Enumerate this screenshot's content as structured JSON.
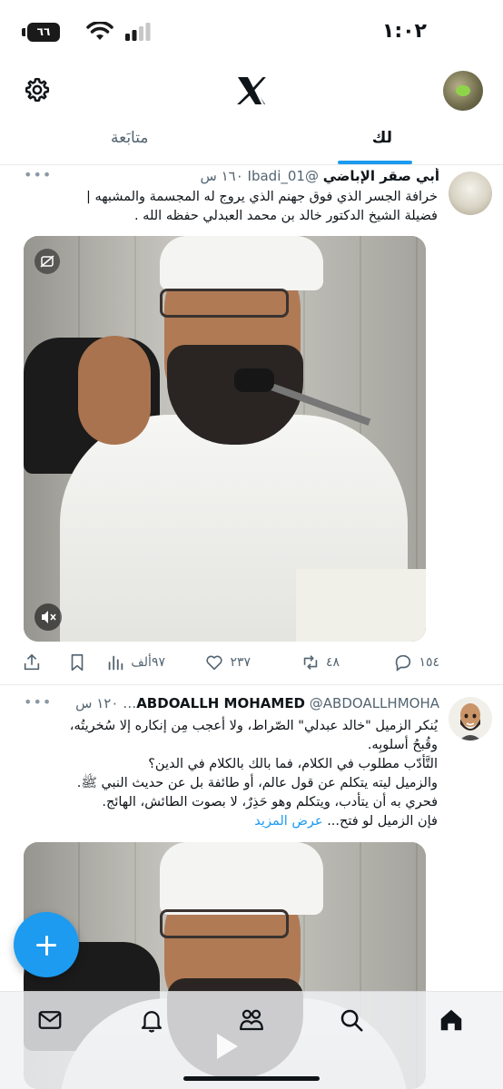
{
  "status_bar": {
    "time": "١:٠٢",
    "battery_level": "٦٦"
  },
  "header": {
    "logo": "x-logo-icon",
    "settings_icon": "gear-icon",
    "profile_icon": "avatar"
  },
  "tabs": {
    "for_you": "لك",
    "following": "متابَعة",
    "active": "لك"
  },
  "tweets": [
    {
      "name": "أبي صقر الإباضي",
      "handle": "@Ibadi_01",
      "time": "١٦٠ س",
      "lines": [
        "خرافة الجسر الذي فوق جهنم الذي يروج له المجسمة والمشبهه |",
        "فضيلة الشيخ الدكتور خالد بن محمد العبدلي حفظه الله ."
      ],
      "stats": {
        "replies": "١٥٤",
        "retweets": "٤٨",
        "likes": "٢٣٧",
        "views": "٩٧ألف"
      }
    },
    {
      "name": "ABDOALLH MOHAMED",
      "handle": "@ABDOALLHMOHA…",
      "time": "١٢٠ س",
      "lines": [
        "يُنكر الزميل \"خالد عبدلي\" الصّراط، ولا أعجب مِن إنكاره إلا سُخريتُه،",
        "وقُبحُ أسلوبِه.",
        "التَّأدّب مطلوب في الكلام، فما بالك بالكلام في الدين؟",
        "والزميل ليته يتكلم عن قول عالم، أو طائفة بل عن حديث النبي ﷺ.",
        "فحري به أن يتأدب، ويتكلم وهو حَذِرٌ، لا بصوت الطائش، الهائج.",
        "فإن الزميل لو فتح..."
      ],
      "show_more": "عرض المزيد"
    }
  ],
  "tab_bar": [
    "home-icon",
    "search-icon",
    "communities-icon",
    "notifications-icon",
    "messages-icon"
  ],
  "colors": {
    "accent": "#1d9bf0",
    "text": "#0f1419",
    "muted": "#536471"
  }
}
